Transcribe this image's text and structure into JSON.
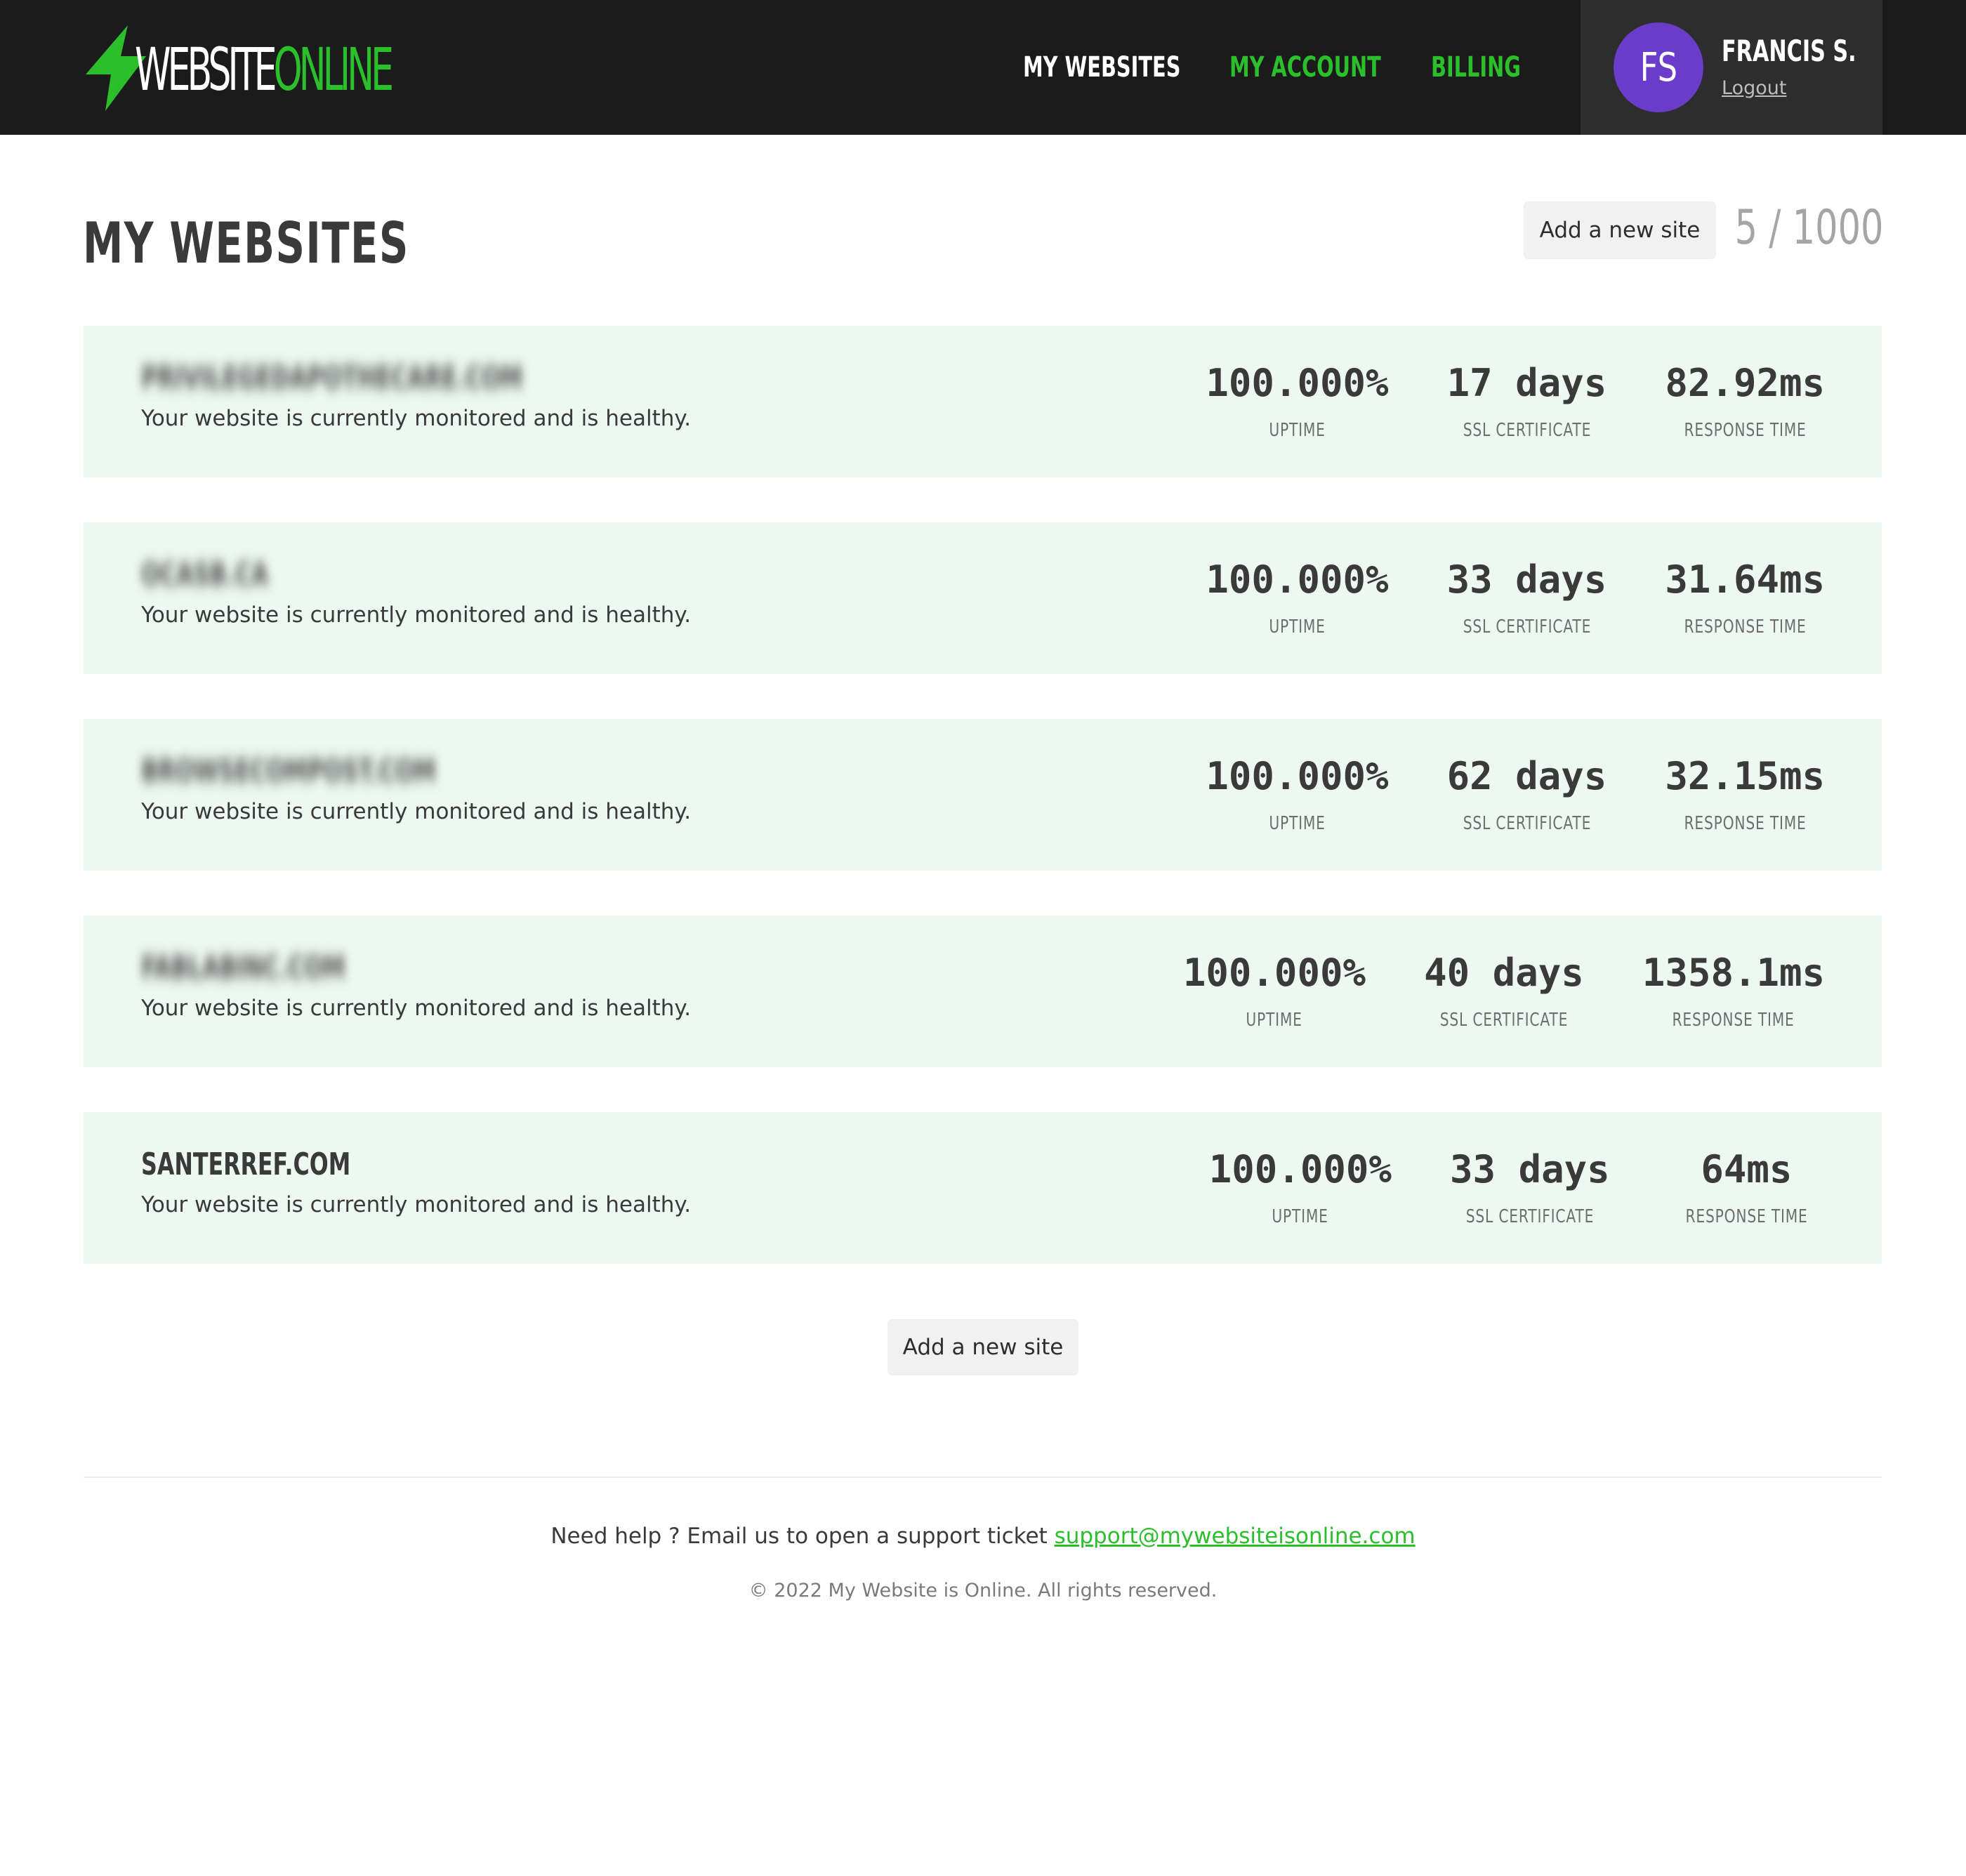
{
  "header": {
    "logo_white": "WEBSITE",
    "logo_green": "ONLINE",
    "nav": [
      {
        "label": "MY WEBSITES"
      },
      {
        "label": "MY ACCOUNT"
      },
      {
        "label": "BILLING"
      }
    ],
    "user": {
      "initials": "FS",
      "name": "FRANCIS S.",
      "logout": "Logout"
    }
  },
  "main": {
    "title": "MY WEBSITES",
    "add_button": "Add a new site",
    "site_count": "5 / 1000",
    "sites": [
      {
        "domain": "PRIVILEGEDAPOTHECARE.COM",
        "status": "Your website is currently monitored and is healthy.",
        "uptime": "100.000%",
        "ssl": "17 days",
        "response": "82.92ms"
      },
      {
        "domain": "OCASB.CA",
        "status": "Your website is currently monitored and is healthy.",
        "uptime": "100.000%",
        "ssl": "33 days",
        "response": "31.64ms"
      },
      {
        "domain": "BROWSECOMPOST.COM",
        "status": "Your website is currently monitored and is healthy.",
        "uptime": "100.000%",
        "ssl": "62 days",
        "response": "32.15ms"
      },
      {
        "domain": "FABLABINC.COM",
        "status": "Your website is currently monitored and is healthy.",
        "uptime": "100.000%",
        "ssl": "40 days",
        "response": "1358.1ms"
      },
      {
        "domain": "SANTERREF.COM",
        "status": "Your website is currently monitored and is healthy.",
        "uptime": "100.000%",
        "ssl": "33 days",
        "response": "64ms"
      }
    ],
    "metric_labels": {
      "uptime": "UPTIME",
      "ssl": "SSL CERTIFICATE",
      "response": "RESPONSE TIME"
    },
    "add_button_bottom": "Add a new site"
  },
  "footer": {
    "help_text": "Need help ? Email us to open a support ticket ",
    "support_email": "support@mywebsiteisonline.com",
    "copyright": "© 2022 My Website is Online. All rights reserved."
  },
  "colors": {
    "accent": "#2bbf2b",
    "header_bg": "#1b1b1b",
    "avatar_bg": "#6a3cc9",
    "card_bg": "#eef8f2"
  },
  "icons": {
    "logo": "lightning-bolt-icon"
  }
}
